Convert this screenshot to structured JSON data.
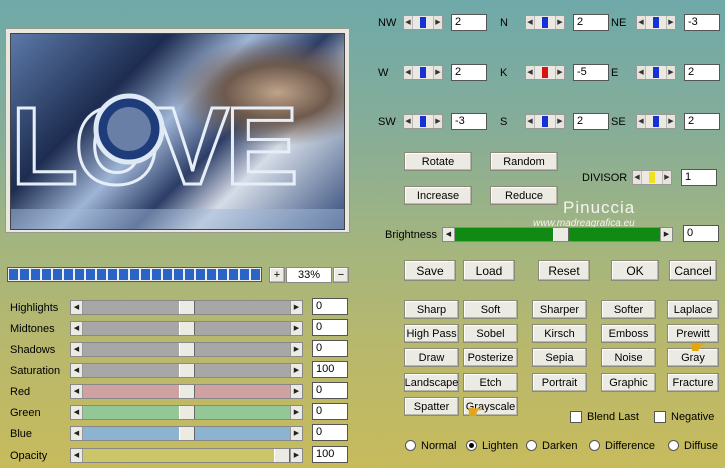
{
  "offsets": {
    "nw": {
      "label": "NW",
      "value": "2"
    },
    "n": {
      "label": "N",
      "value": "2"
    },
    "ne": {
      "label": "NE",
      "value": "-3"
    },
    "w": {
      "label": "W",
      "value": "2"
    },
    "k": {
      "label": "K",
      "value": "-5"
    },
    "e": {
      "label": "E",
      "value": "2"
    },
    "sw": {
      "label": "SW",
      "value": "-3"
    },
    "s": {
      "label": "S",
      "value": "2"
    },
    "se": {
      "label": "SE",
      "value": "2"
    }
  },
  "buttons": {
    "rotate": "Rotate",
    "random": "Random",
    "increase": "Increase",
    "reduce": "Reduce",
    "save": "Save",
    "load": "Load",
    "reset": "Reset",
    "ok": "OK",
    "cancel": "Cancel"
  },
  "divisor": {
    "label": "DIVISOR",
    "value": "1"
  },
  "brightness": {
    "label": "Brightness",
    "value": "0",
    "level_percent": 52
  },
  "preview": {
    "zoom": "33%",
    "plus": "+",
    "minus": "−",
    "word": "LOVE"
  },
  "watermark": {
    "name": "Pinuccia",
    "site": "www.madreagrafica.eu"
  },
  "adjust": [
    {
      "label": "Highlights",
      "value": "0",
      "color": "#a7a7a7",
      "level_percent": 50
    },
    {
      "label": "Midtones",
      "value": "0",
      "color": "#a7a7a7",
      "level_percent": 50
    },
    {
      "label": "Shadows",
      "value": "0",
      "color": "#a7a7a7",
      "level_percent": 50
    },
    {
      "label": "Saturation",
      "value": "100",
      "color": "#a7a7a7",
      "level_percent": 50
    },
    {
      "label": "Red",
      "value": "0",
      "color": "#cfa1a1",
      "level_percent": 50
    },
    {
      "label": "Green",
      "value": "0",
      "color": "#93c796",
      "level_percent": 50
    },
    {
      "label": "Blue",
      "value": "0",
      "color": "#8cb3cf",
      "level_percent": 50
    },
    {
      "label": "Opacity",
      "value": "100",
      "color": "#cdc668",
      "level_percent": 100
    }
  ],
  "presets": [
    [
      "Sharp",
      "Soft",
      "Sharper",
      "Softer",
      "Laplace"
    ],
    [
      "High Pass",
      "Sobel",
      "Kirsch",
      "Emboss",
      "Prewitt"
    ],
    [
      "Draw",
      "Posterize",
      "Sepia",
      "Noise",
      "Gray"
    ],
    [
      "Landscape",
      "Etch",
      "Portrait",
      "Graphic",
      "Fracture"
    ],
    [
      "Spatter",
      "Grayscale"
    ]
  ],
  "options": {
    "blend_last": "Blend Last",
    "negative": "Negative"
  },
  "modes": {
    "items": [
      "Normal",
      "Lighten",
      "Darken",
      "Difference",
      "Diffuse"
    ],
    "selected": "Lighten"
  }
}
